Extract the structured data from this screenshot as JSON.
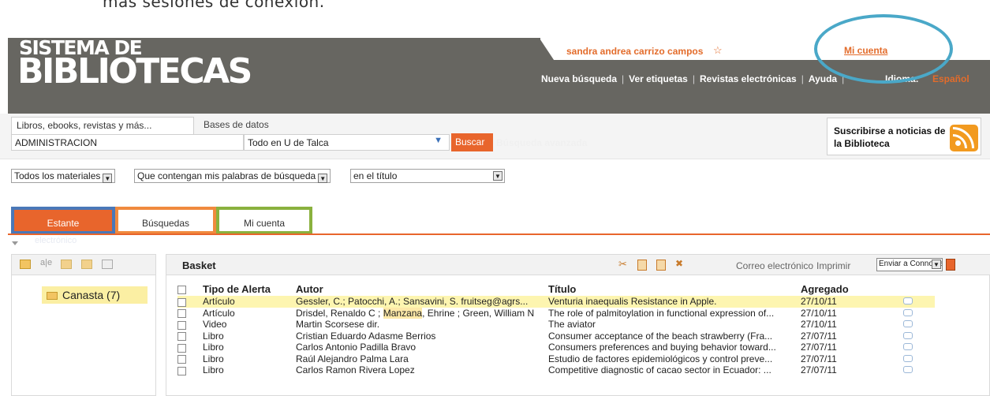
{
  "doc_text": "más sesiones de conexión.",
  "header": {
    "logo_line1": "SISTEMA DE",
    "logo_line2": "BIBLIOTECAS",
    "user_name": "sandra andrea carrizo campos",
    "account_link": "Mi cuenta",
    "nav": [
      "Nueva búsqueda",
      "Ver etiquetas",
      "Revistas electrónicas",
      "Ayuda"
    ],
    "language_label": "Idioma:",
    "language_value": "Español"
  },
  "search": {
    "tab_active": "Libros, ebooks, revistas y más...",
    "tab_other": "Bases de datos",
    "query": "ADMINISTRACION",
    "scope": "Todo en U de Talca",
    "button": "Buscar",
    "advanced": "Búsqueda avanzada",
    "subscribe": "Suscribirse a noticias de la Biblioteca"
  },
  "filters": [
    "Todos los materiales",
    "Que contengan mis palabras de búsqueda",
    "en el título"
  ],
  "tabs": {
    "estante": "Estante",
    "estante_sub": "electrónico",
    "busquedas": "Búsquedas",
    "micuenta": "Mi cuenta"
  },
  "folders": [
    {
      "label": "Canasta (7)"
    }
  ],
  "basket": {
    "title": "Basket",
    "email": "Correo electrónico",
    "print": "Imprimir",
    "send_select": "Enviar a Connotea",
    "columns": [
      "Tipo de Alerta",
      "Autor",
      "Título",
      "Agregado"
    ],
    "rows": [
      {
        "type": "Artículo",
        "author": "Gessler, C.; Patocchi, A.; Sansavini, S. fruitseg@agrs...",
        "title": "Venturia inaequalis Resistance in Apple.",
        "date": "27/10/11"
      },
      {
        "type": "Artículo",
        "author_pre": "Drisdel, Renaldo C ; ",
        "author_mark": "Manzana",
        "author_post": ", Ehrine ; Green, William N",
        "title": "The role of palmitoylation in functional expression of...",
        "date": "27/10/11"
      },
      {
        "type": "Video",
        "author": "Martin Scorsese dir.",
        "title": "The aviator",
        "date": "27/10/11"
      },
      {
        "type": "Libro",
        "author": "Cristian Eduardo Adasme Berrios",
        "title": "Consumer acceptance of the beach strawberry (Fra...",
        "date": "27/07/11"
      },
      {
        "type": "Libro",
        "author": "Carlos Antonio Padilla Bravo",
        "title": "Consumers preferences and buying behavior toward...",
        "date": "27/07/11"
      },
      {
        "type": "Libro",
        "author": "Raúl Alejandro Palma Lara",
        "title": "Estudio de factores epidemiológicos y control preve...",
        "date": "27/07/11"
      },
      {
        "type": "Libro",
        "author": "Carlos Ramon Rivera Lopez",
        "title": "Competitive diagnostic of cacao sector in Ecuador: ...",
        "date": "27/07/11"
      }
    ]
  },
  "colors": {
    "accent": "#e8652c",
    "header_bg": "#676661",
    "highlight": "#fdf5b0"
  }
}
